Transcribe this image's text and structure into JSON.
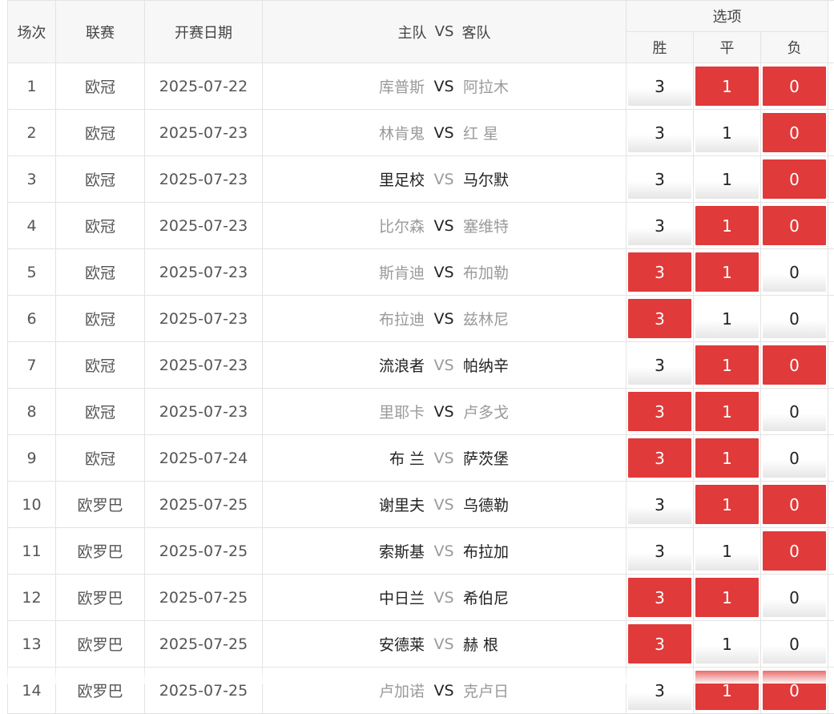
{
  "header": {
    "col_index": "场次",
    "col_league": "联赛",
    "col_date": "开赛日期",
    "col_home": "主队",
    "col_vs": "VS",
    "col_away": "客队",
    "col_options": "选项",
    "opt_win": "胜",
    "opt_draw": "平",
    "opt_lose": "负"
  },
  "rows": [
    {
      "idx": "1",
      "league": "欧冠",
      "date": "2025-07-22",
      "home": "库普斯",
      "away": "阿拉木",
      "vs": "VS",
      "win": "3",
      "draw": "1",
      "lose": "0",
      "sel": [
        false,
        true,
        true
      ],
      "tone": [
        "light",
        "dark",
        "light"
      ]
    },
    {
      "idx": "2",
      "league": "欧冠",
      "date": "2025-07-23",
      "home": "林肯鬼",
      "away": "红 星",
      "vs": "VS",
      "win": "3",
      "draw": "1",
      "lose": "0",
      "sel": [
        false,
        false,
        true
      ],
      "tone": [
        "light",
        "dark",
        "light"
      ]
    },
    {
      "idx": "3",
      "league": "欧冠",
      "date": "2025-07-23",
      "home": "里足校",
      "away": "马尔默",
      "vs": "VS",
      "win": "3",
      "draw": "1",
      "lose": "0",
      "sel": [
        false,
        false,
        true
      ],
      "tone": [
        "dark",
        "light",
        "dark"
      ]
    },
    {
      "idx": "4",
      "league": "欧冠",
      "date": "2025-07-23",
      "home": "比尔森",
      "away": "塞维特",
      "vs": "VS",
      "win": "3",
      "draw": "1",
      "lose": "0",
      "sel": [
        false,
        true,
        true
      ],
      "tone": [
        "light",
        "dark",
        "light"
      ]
    },
    {
      "idx": "5",
      "league": "欧冠",
      "date": "2025-07-23",
      "home": "斯肯迪",
      "away": "布加勒",
      "vs": "VS",
      "win": "3",
      "draw": "1",
      "lose": "0",
      "sel": [
        true,
        true,
        false
      ],
      "tone": [
        "light",
        "dark",
        "light"
      ]
    },
    {
      "idx": "6",
      "league": "欧冠",
      "date": "2025-07-23",
      "home": "布拉迪",
      "away": "兹林尼",
      "vs": "VS",
      "win": "3",
      "draw": "1",
      "lose": "0",
      "sel": [
        true,
        false,
        false
      ],
      "tone": [
        "light",
        "dark",
        "light"
      ]
    },
    {
      "idx": "7",
      "league": "欧冠",
      "date": "2025-07-23",
      "home": "流浪者",
      "away": "帕纳辛",
      "vs": "VS",
      "win": "3",
      "draw": "1",
      "lose": "0",
      "sel": [
        false,
        true,
        true
      ],
      "tone": [
        "dark",
        "light",
        "dark"
      ]
    },
    {
      "idx": "8",
      "league": "欧冠",
      "date": "2025-07-23",
      "home": "里耶卡",
      "away": "卢多戈",
      "vs": "VS",
      "win": "3",
      "draw": "1",
      "lose": "0",
      "sel": [
        true,
        true,
        false
      ],
      "tone": [
        "light",
        "dark",
        "light"
      ]
    },
    {
      "idx": "9",
      "league": "欧冠",
      "date": "2025-07-24",
      "home": "布 兰",
      "away": "萨茨堡",
      "vs": "VS",
      "win": "3",
      "draw": "1",
      "lose": "0",
      "sel": [
        true,
        true,
        false
      ],
      "tone": [
        "dark",
        "light",
        "dark"
      ]
    },
    {
      "idx": "10",
      "league": "欧罗巴",
      "date": "2025-07-25",
      "home": "谢里夫",
      "away": "乌德勒",
      "vs": "VS",
      "win": "3",
      "draw": "1",
      "lose": "0",
      "sel": [
        false,
        true,
        true
      ],
      "tone": [
        "dark",
        "light",
        "dark"
      ]
    },
    {
      "idx": "11",
      "league": "欧罗巴",
      "date": "2025-07-25",
      "home": "索斯基",
      "away": "布拉加",
      "vs": "VS",
      "win": "3",
      "draw": "1",
      "lose": "0",
      "sel": [
        false,
        false,
        true
      ],
      "tone": [
        "dark",
        "light",
        "dark"
      ]
    },
    {
      "idx": "12",
      "league": "欧罗巴",
      "date": "2025-07-25",
      "home": "中日兰",
      "away": "希伯尼",
      "vs": "VS",
      "win": "3",
      "draw": "1",
      "lose": "0",
      "sel": [
        true,
        true,
        false
      ],
      "tone": [
        "dark",
        "light",
        "dark"
      ]
    },
    {
      "idx": "13",
      "league": "欧罗巴",
      "date": "2025-07-25",
      "home": "安德莱",
      "away": "赫 根",
      "vs": "VS",
      "win": "3",
      "draw": "1",
      "lose": "0",
      "sel": [
        true,
        false,
        false
      ],
      "tone": [
        "dark",
        "light",
        "dark"
      ]
    },
    {
      "idx": "14",
      "league": "欧罗巴",
      "date": "2025-07-25",
      "home": "卢加诺",
      "away": "克卢日",
      "vs": "VS",
      "win": "3",
      "draw": "1",
      "lose": "0",
      "sel": [
        false,
        true,
        true
      ],
      "tone": [
        "light",
        "dark",
        "light"
      ]
    }
  ],
  "colors": {
    "selected": "#e03a3a",
    "header_bg": "#f7f7f7",
    "border": "#e3e3e3"
  }
}
